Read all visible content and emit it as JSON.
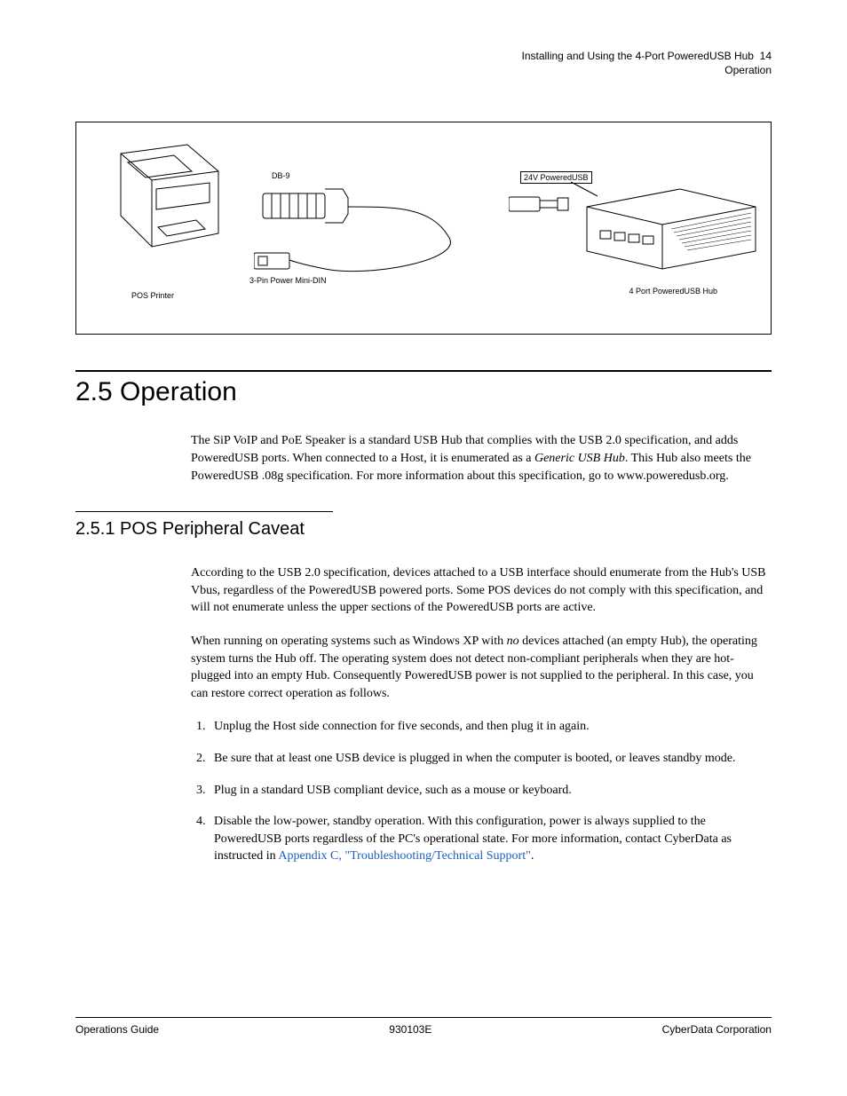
{
  "header": {
    "line1": "Installing and Using the 4-Port PoweredUSB Hub",
    "page_num": "14",
    "line2": "Operation"
  },
  "figure": {
    "printer_label": "POS Printer",
    "db9_label": "DB-9",
    "mini_din_label": "3-Pin Power Mini-DIN",
    "pusb_label": "24V PoweredUSB",
    "hub_label": "4 Port PoweredUSB Hub"
  },
  "section": {
    "num_title": "2.5 Operation",
    "para1_a": "The SiP VoIP and PoE Speaker is a standard USB Hub that complies with the USB 2.0 specification, and adds PoweredUSB ports. When connected to a Host, it is enumerated as a ",
    "para1_em": "Generic USB Hub",
    "para1_b": ". This Hub also meets the PoweredUSB .08g specification. For more information about this specification, go to www.poweredusb.org."
  },
  "subsection": {
    "num_title": "2.5.1 POS Peripheral Caveat",
    "para1": "According to the USB 2.0 specification, devices attached to a USB interface should enumerate from the Hub's USB Vbus, regardless of the PoweredUSB powered ports. Some POS devices do not comply with this specification, and will not enumerate unless the upper sections of the PoweredUSB ports are active.",
    "para2_a": "When running on operating systems such as Windows XP with ",
    "para2_em": "no",
    "para2_b": " devices attached (an empty Hub), the operating system turns the Hub off. The operating system does not detect non-compliant peripherals when they are hot-plugged into an empty Hub. Consequently PoweredUSB power is not supplied to the peripheral. In this case, you can restore correct operation as follows.",
    "steps": [
      "Unplug the Host side connection for five seconds, and then plug it in again.",
      "Be sure that at least one USB device is plugged in when the computer is booted, or leaves standby mode.",
      "Plug in a standard USB compliant device, such as a mouse or keyboard."
    ],
    "step4_a": "Disable the low-power, standby operation. With this configuration, power is always supplied to the PoweredUSB ports regardless of the PC's operational state. For more information, contact CyberData as instructed in ",
    "step4_link": "Appendix C, \"Troubleshooting/Technical Support\"",
    "step4_b": "."
  },
  "footer": {
    "left": "Operations Guide",
    "center": "930103E",
    "right": "CyberData Corporation"
  }
}
